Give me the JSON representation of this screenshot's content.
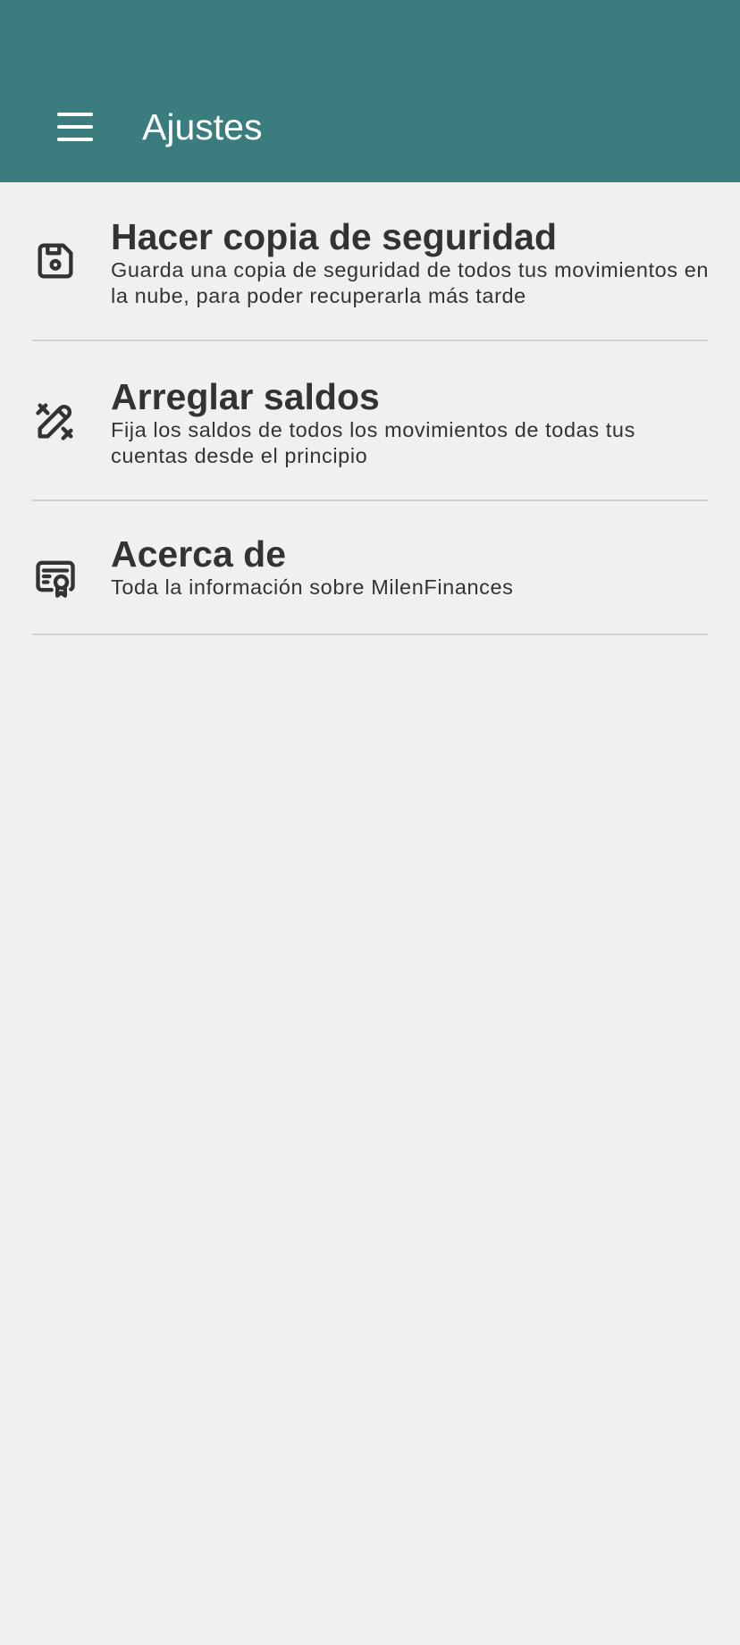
{
  "app_bar": {
    "title": "Ajustes",
    "menu_icon": "hamburger-menu-icon",
    "background_color": "#3b7d7f"
  },
  "settings": {
    "items": [
      {
        "title": "Hacer copia de seguridad",
        "description": "Guarda una copia de seguridad de todos tus movimientos en la nube, para poder recuperarla más tarde",
        "icon": "floppy-disk-icon"
      },
      {
        "title": "Arreglar saldos",
        "description": "Fija los saldos de todos los movimientos de todas tus cuentas desde el principio",
        "icon": "ruler-pencil-icon"
      },
      {
        "title": "Acerca de",
        "description": "Toda la información sobre MilenFinances",
        "icon": "certificate-icon"
      }
    ]
  }
}
